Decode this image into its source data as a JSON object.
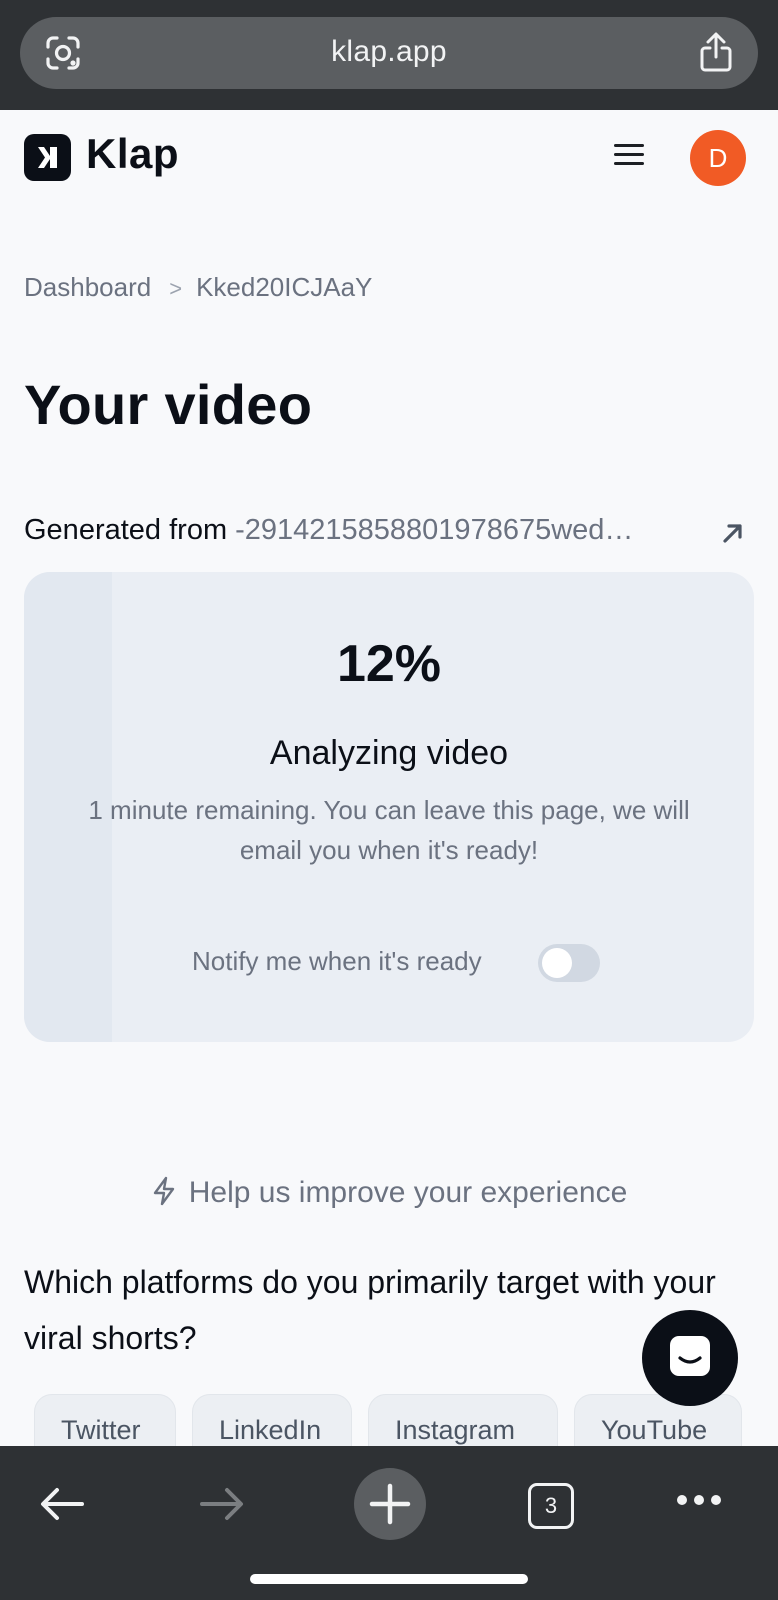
{
  "browser": {
    "url": "klap.app",
    "tab_count": "3"
  },
  "header": {
    "logo_text": "Klap",
    "avatar_initial": "D"
  },
  "breadcrumb": {
    "root": "Dashboard",
    "current": "Kked20ICJAaY"
  },
  "page": {
    "title": "Your video",
    "generated_label": "Generated from",
    "generated_source": "-2914215858801978675wed…"
  },
  "progress": {
    "percent_text": "12%",
    "fraction": 0.12,
    "status": "Analyzing video",
    "description": "1 minute remaining. You can leave this page, we will email you when it's ready!",
    "notify_label": "Notify me when it's ready",
    "notify_enabled": false
  },
  "survey": {
    "help_text": "Help us improve your experience",
    "question": "Which platforms do you primarily target with your viral shorts?",
    "options": [
      "Twitter",
      "LinkedIn",
      "Instagram",
      "YouTube"
    ]
  },
  "colors": {
    "brand": "#0b0f17",
    "avatar": "#f15b25",
    "card": "#eaeef4"
  },
  "icons": {
    "url_left": "google-lens-icon",
    "url_right": "share-icon",
    "nav": [
      "back-arrow-icon",
      "forward-arrow-icon",
      "new-tab-plus-icon",
      "tabs-icon",
      "more-dots-icon"
    ]
  }
}
